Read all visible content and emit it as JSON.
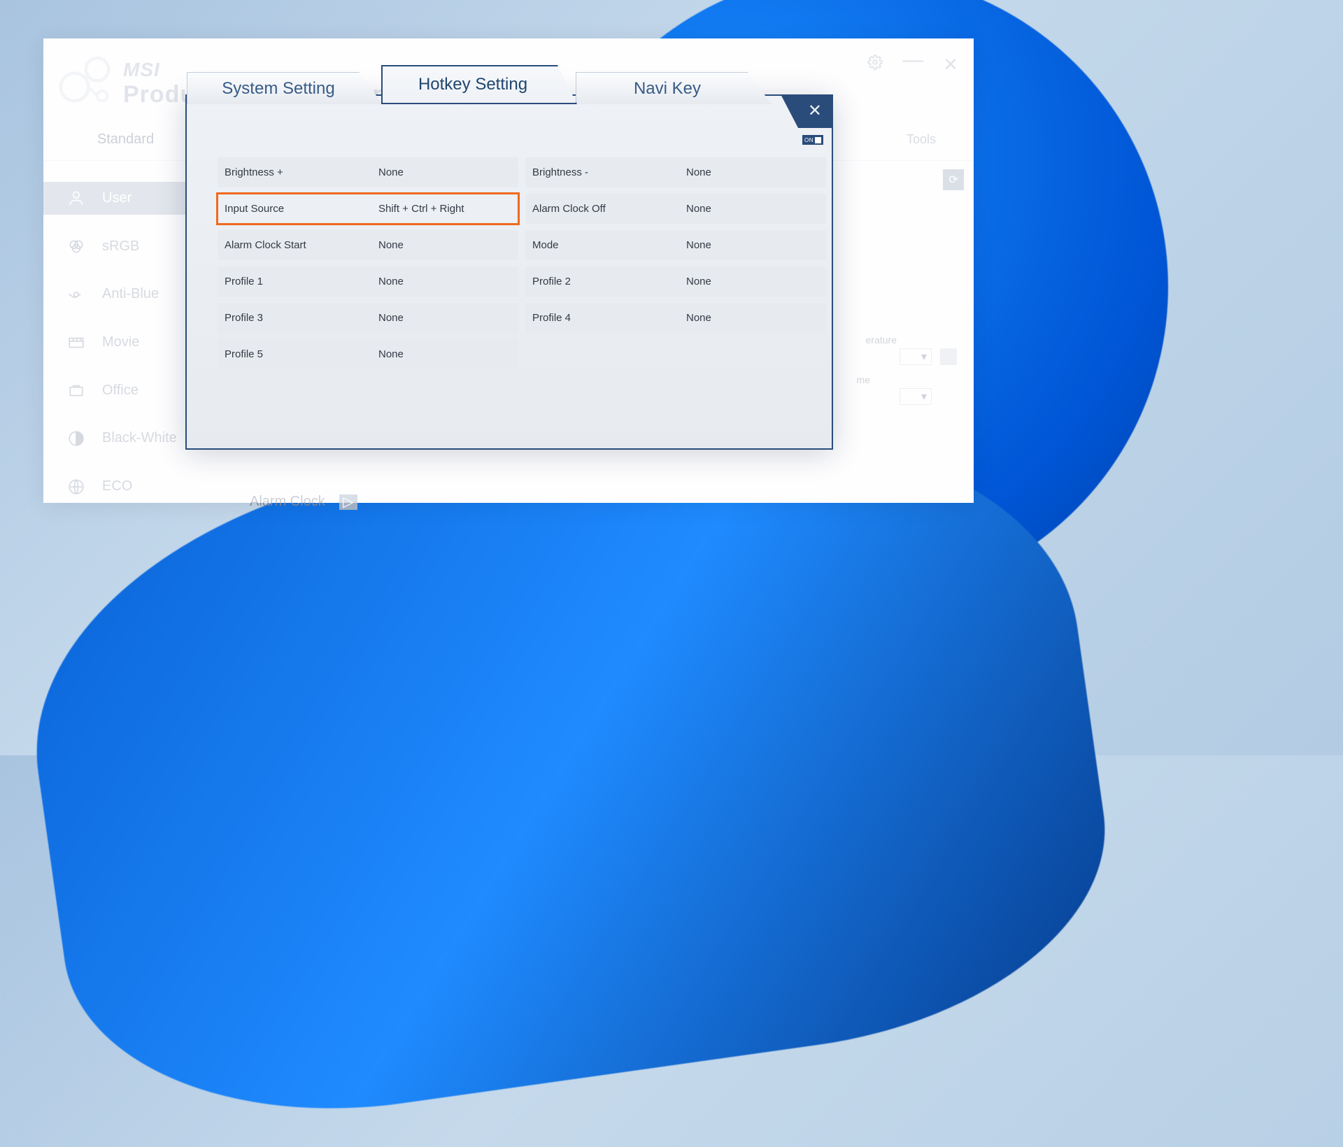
{
  "brand": {
    "top": "MSI",
    "sub": "Productivity Intelligence"
  },
  "nav": {
    "side_tab": "Standard",
    "tools": "Tools"
  },
  "sidebar": {
    "items": [
      {
        "label": "User",
        "icon": "user-icon",
        "active": true
      },
      {
        "label": "sRGB",
        "icon": "srgb-icon",
        "active": false
      },
      {
        "label": "Anti-Blue",
        "icon": "anti-blue-icon",
        "active": false
      },
      {
        "label": "Movie",
        "icon": "movie-icon",
        "active": false
      },
      {
        "label": "Office",
        "icon": "office-icon",
        "active": false
      },
      {
        "label": "Black-White",
        "icon": "black-white-icon",
        "active": false
      },
      {
        "label": "ECO",
        "icon": "eco-icon",
        "active": false
      }
    ]
  },
  "content": {
    "temperature_label": "erature",
    "time_label": "me",
    "caret": "▾",
    "alarm_label": "Alarm Clock",
    "play_glyph": "▷",
    "reset_glyph": "⟳"
  },
  "modal": {
    "tabs": [
      {
        "label": "System Setting",
        "active": false
      },
      {
        "label": "Hotkey Setting",
        "active": true
      },
      {
        "label": "Navi Key",
        "active": false
      }
    ],
    "close_glyph": "✕",
    "toggle_label": "ON",
    "rows_left": [
      {
        "label": "Brightness +",
        "value": "None",
        "highlight": false
      },
      {
        "label": "Input Source",
        "value": "Shift + Ctrl + Right",
        "highlight": true
      },
      {
        "label": "Alarm Clock Start",
        "value": "None",
        "highlight": false
      },
      {
        "label": "Profile 1",
        "value": "None",
        "highlight": false
      },
      {
        "label": "Profile 3",
        "value": "None",
        "highlight": false
      },
      {
        "label": "Profile 5",
        "value": "None",
        "highlight": false
      }
    ],
    "rows_right": [
      {
        "label": "Brightness -",
        "value": "None",
        "highlight": false
      },
      {
        "label": "Alarm Clock Off",
        "value": "None",
        "highlight": false
      },
      {
        "label": "Mode",
        "value": "None",
        "highlight": false
      },
      {
        "label": "Profile 2",
        "value": "None",
        "highlight": false
      },
      {
        "label": "Profile 4",
        "value": "None",
        "highlight": false
      }
    ]
  }
}
